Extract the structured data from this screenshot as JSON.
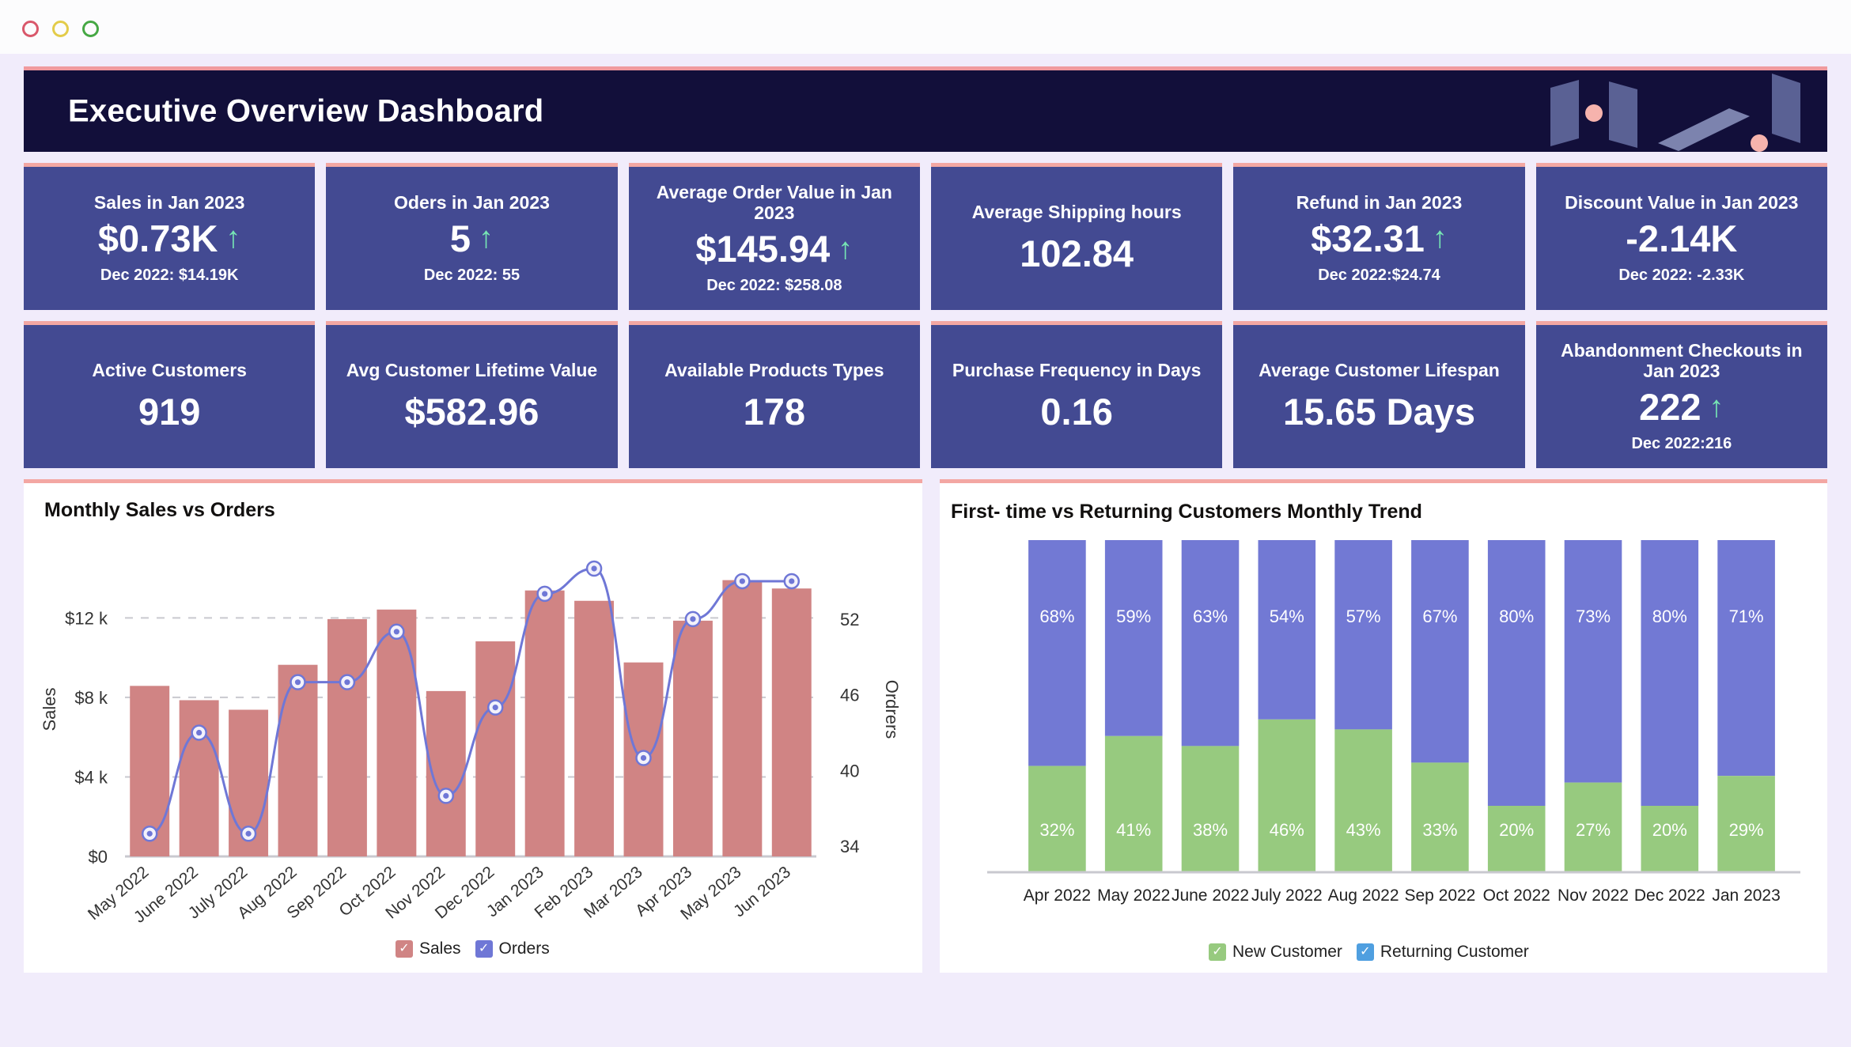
{
  "window": {
    "controls": [
      {
        "name": "close",
        "color": "#d9586b"
      },
      {
        "name": "minimize",
        "color": "#e3cc4a"
      },
      {
        "name": "maximize",
        "color": "#46a844"
      }
    ]
  },
  "header": {
    "title": "Executive Overview Dashboard",
    "background": "#120f3a",
    "accent": "#f09a9e"
  },
  "theme": {
    "card_bg": "#434a92",
    "card_accent": "#f3a7a3",
    "page_bg": "#f1ecfb",
    "up_arrow": "#76e6b4",
    "bar_sales": "#d08484",
    "line_orders": "#6f77d6",
    "bar_new_customer": "#97ca7f",
    "bar_returning_customer": "#7279d4"
  },
  "kpis_row1": [
    {
      "label": "Sales in Jan 2023",
      "value": "$0.73K",
      "arrow": "↑",
      "sub": "Dec 2022: $14.19K"
    },
    {
      "label": "Oders in Jan 2023",
      "value": "5",
      "arrow": "↑",
      "sub": "Dec 2022: 55"
    },
    {
      "label": "Average Order Value in Jan 2023",
      "value": "$145.94",
      "arrow": "↑",
      "sub": "Dec 2022: $258.08"
    },
    {
      "label": "Average Shipping hours",
      "value": "102.84",
      "arrow": "",
      "sub": ""
    },
    {
      "label": "Refund in Jan 2023",
      "value": "$32.31",
      "arrow": "↑",
      "sub": "Dec 2022:$24.74"
    },
    {
      "label": "Discount Value in Jan 2023",
      "value": "-2.14K",
      "arrow": "",
      "sub": "Dec 2022:  -2.33K"
    }
  ],
  "kpis_row2": [
    {
      "label": "Active Customers",
      "value": "919",
      "arrow": "",
      "sub": ""
    },
    {
      "label": "Avg Customer Lifetime Value",
      "value": "$582.96",
      "arrow": "",
      "sub": ""
    },
    {
      "label": "Available Products Types",
      "value": "178",
      "arrow": "",
      "sub": ""
    },
    {
      "label": "Purchase Frequency in Days",
      "value": "0.16",
      "arrow": "",
      "sub": ""
    },
    {
      "label": "Average Customer Lifespan",
      "value": "15.65 Days",
      "arrow": "",
      "sub": ""
    },
    {
      "label": "Abandonment Checkouts in Jan 2023",
      "value": "222",
      "arrow": "↑",
      "sub": "Dec 2022:216"
    }
  ],
  "left_chart": {
    "title": "Monthly Sales vs Orders",
    "legend": [
      {
        "label": "Sales",
        "swatch": "sw-sales"
      },
      {
        "label": "Orders",
        "swatch": "sw-orders"
      }
    ]
  },
  "right_chart": {
    "title": "First- time vs Returning  Customers Monthly Trend",
    "legend": [
      {
        "label": "New Customer",
        "swatch": "sw-new"
      },
      {
        "label": "Returning Customer",
        "swatch": "sw-ret"
      }
    ]
  },
  "chart_data": [
    {
      "type": "bar",
      "id": "monthly-sales-vs-orders",
      "title": "Monthly Sales vs Orders",
      "xlabel": "",
      "ylabel": "Sales",
      "y2label": "Ordrers",
      "grid": true,
      "legend_position": "bottom-right",
      "categories": [
        "May 2022",
        "June 2022",
        "July 2022",
        "Aug 2022",
        "Sep 2022",
        "Oct 2022",
        "Nov 2022",
        "Dec 2022",
        "Jan 2023",
        "Feb 2023",
        "Mar 2023",
        "Apr 2023",
        "May 2023",
        "Jun 2023"
      ],
      "yticks": [
        "$0",
        "$4 k",
        "$8 k",
        "$12 k"
      ],
      "ytick_values": [
        0,
        4000,
        8000,
        12000
      ],
      "ylim": [
        0,
        14800
      ],
      "y2ticks": [
        "34",
        "40",
        "46",
        "52"
      ],
      "y2tick_values": [
        34,
        40,
        46,
        52
      ],
      "y2lim": [
        33.2,
        56.5
      ],
      "series": [
        {
          "name": "Sales",
          "kind": "bar",
          "color": "#d08484",
          "axis": "left",
          "values": [
            8580,
            7860,
            7380,
            9640,
            11940,
            12420,
            8320,
            10820,
            13380,
            12860,
            9760,
            11860,
            13900,
            13480
          ]
        },
        {
          "name": "Orders",
          "kind": "line",
          "color": "#6f77d6",
          "axis": "right",
          "values": [
            35,
            43,
            35,
            47,
            47,
            51,
            38,
            45,
            54,
            56,
            41,
            52,
            55,
            55
          ]
        }
      ]
    },
    {
      "type": "bar",
      "id": "first-time-vs-returning-customers",
      "subtype": "stacked-100",
      "title": "First- time vs Returning  Customers Monthly Trend",
      "xlabel": "",
      "ylabel": "",
      "grid": false,
      "legend_position": "bottom-center",
      "categories": [
        "Apr 2022",
        "May 2022",
        "June 2022",
        "July 2022",
        "Aug 2022",
        "Sep 2022",
        "Oct 2022",
        "Nov 2022",
        "Dec 2022",
        "Jan 2023"
      ],
      "series": [
        {
          "name": "New Customer",
          "color": "#97ca7f",
          "values": [
            32,
            41,
            38,
            46,
            43,
            33,
            20,
            27,
            20,
            29
          ],
          "labels": [
            "32%",
            "41%",
            "38%",
            "46%",
            "43%",
            "33%",
            "20%",
            "27%",
            "20%",
            "29%"
          ]
        },
        {
          "name": "Returning Customer",
          "color": "#7279d4",
          "values": [
            68,
            59,
            63,
            54,
            57,
            67,
            80,
            73,
            80,
            71
          ],
          "labels": [
            "68%",
            "59%",
            "63%",
            "54%",
            "57%",
            "67%",
            "80%",
            "73%",
            "80%",
            "71%"
          ]
        }
      ]
    }
  ]
}
